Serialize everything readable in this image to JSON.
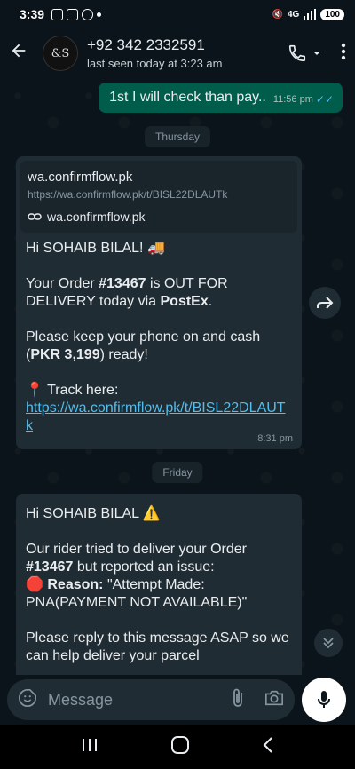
{
  "status_bar": {
    "time": "3:39",
    "signal_text": "4G",
    "battery": "100"
  },
  "header": {
    "avatar_text": "&S",
    "contact_name": "+92 342 2332591",
    "contact_status": "last seen today at 3:23 am"
  },
  "messages": {
    "outgoing_1": {
      "text": "1st I will check than pay..",
      "time": "11:56 pm"
    },
    "day_1": "Thursday",
    "incoming_1": {
      "link_title": "wa.confirmflow.pk",
      "link_url": "https://wa.confirmflow.pk/t/BISL22DLAUTk",
      "link_domain": "wa.confirmflow.pk",
      "greeting": "Hi SOHAIB BILAL! 🚚",
      "line2_pre": "Your Order ",
      "order_no": "#13467",
      "line2_mid": " is OUT FOR DELIVERY today via ",
      "courier": "PostEx",
      "line2_end": ".",
      "line3_pre": "Please keep your phone on and cash (",
      "amount": "PKR 3,199",
      "line3_end": ") ready!",
      "track_label": "📍 Track here:",
      "track_link": "https://wa.confirmflow.pk/t/BISL22DLAUTk",
      "time": "8:31 pm"
    },
    "day_2": "Friday",
    "incoming_2": {
      "greeting": "Hi SOHAIB BILAL ⚠️",
      "line2_pre": "Our rider tried to deliver your Order ",
      "order_no": "#13467",
      "line2_end": " but reported an issue:",
      "reason_icon": "🛑",
      "reason_label": "Reason:",
      "reason_text": " \"Attempt Made: PNA(PAYMENT NOT AVAILABLE)\"",
      "line4": "Please reply to this message ASAP so we can help deliver your parcel"
    }
  },
  "input": {
    "placeholder": "Message"
  },
  "colors": {
    "outgoing_bubble": "#005c4b",
    "incoming_bubble": "#202c33",
    "background": "#0b141a",
    "link": "#53bdeb"
  }
}
